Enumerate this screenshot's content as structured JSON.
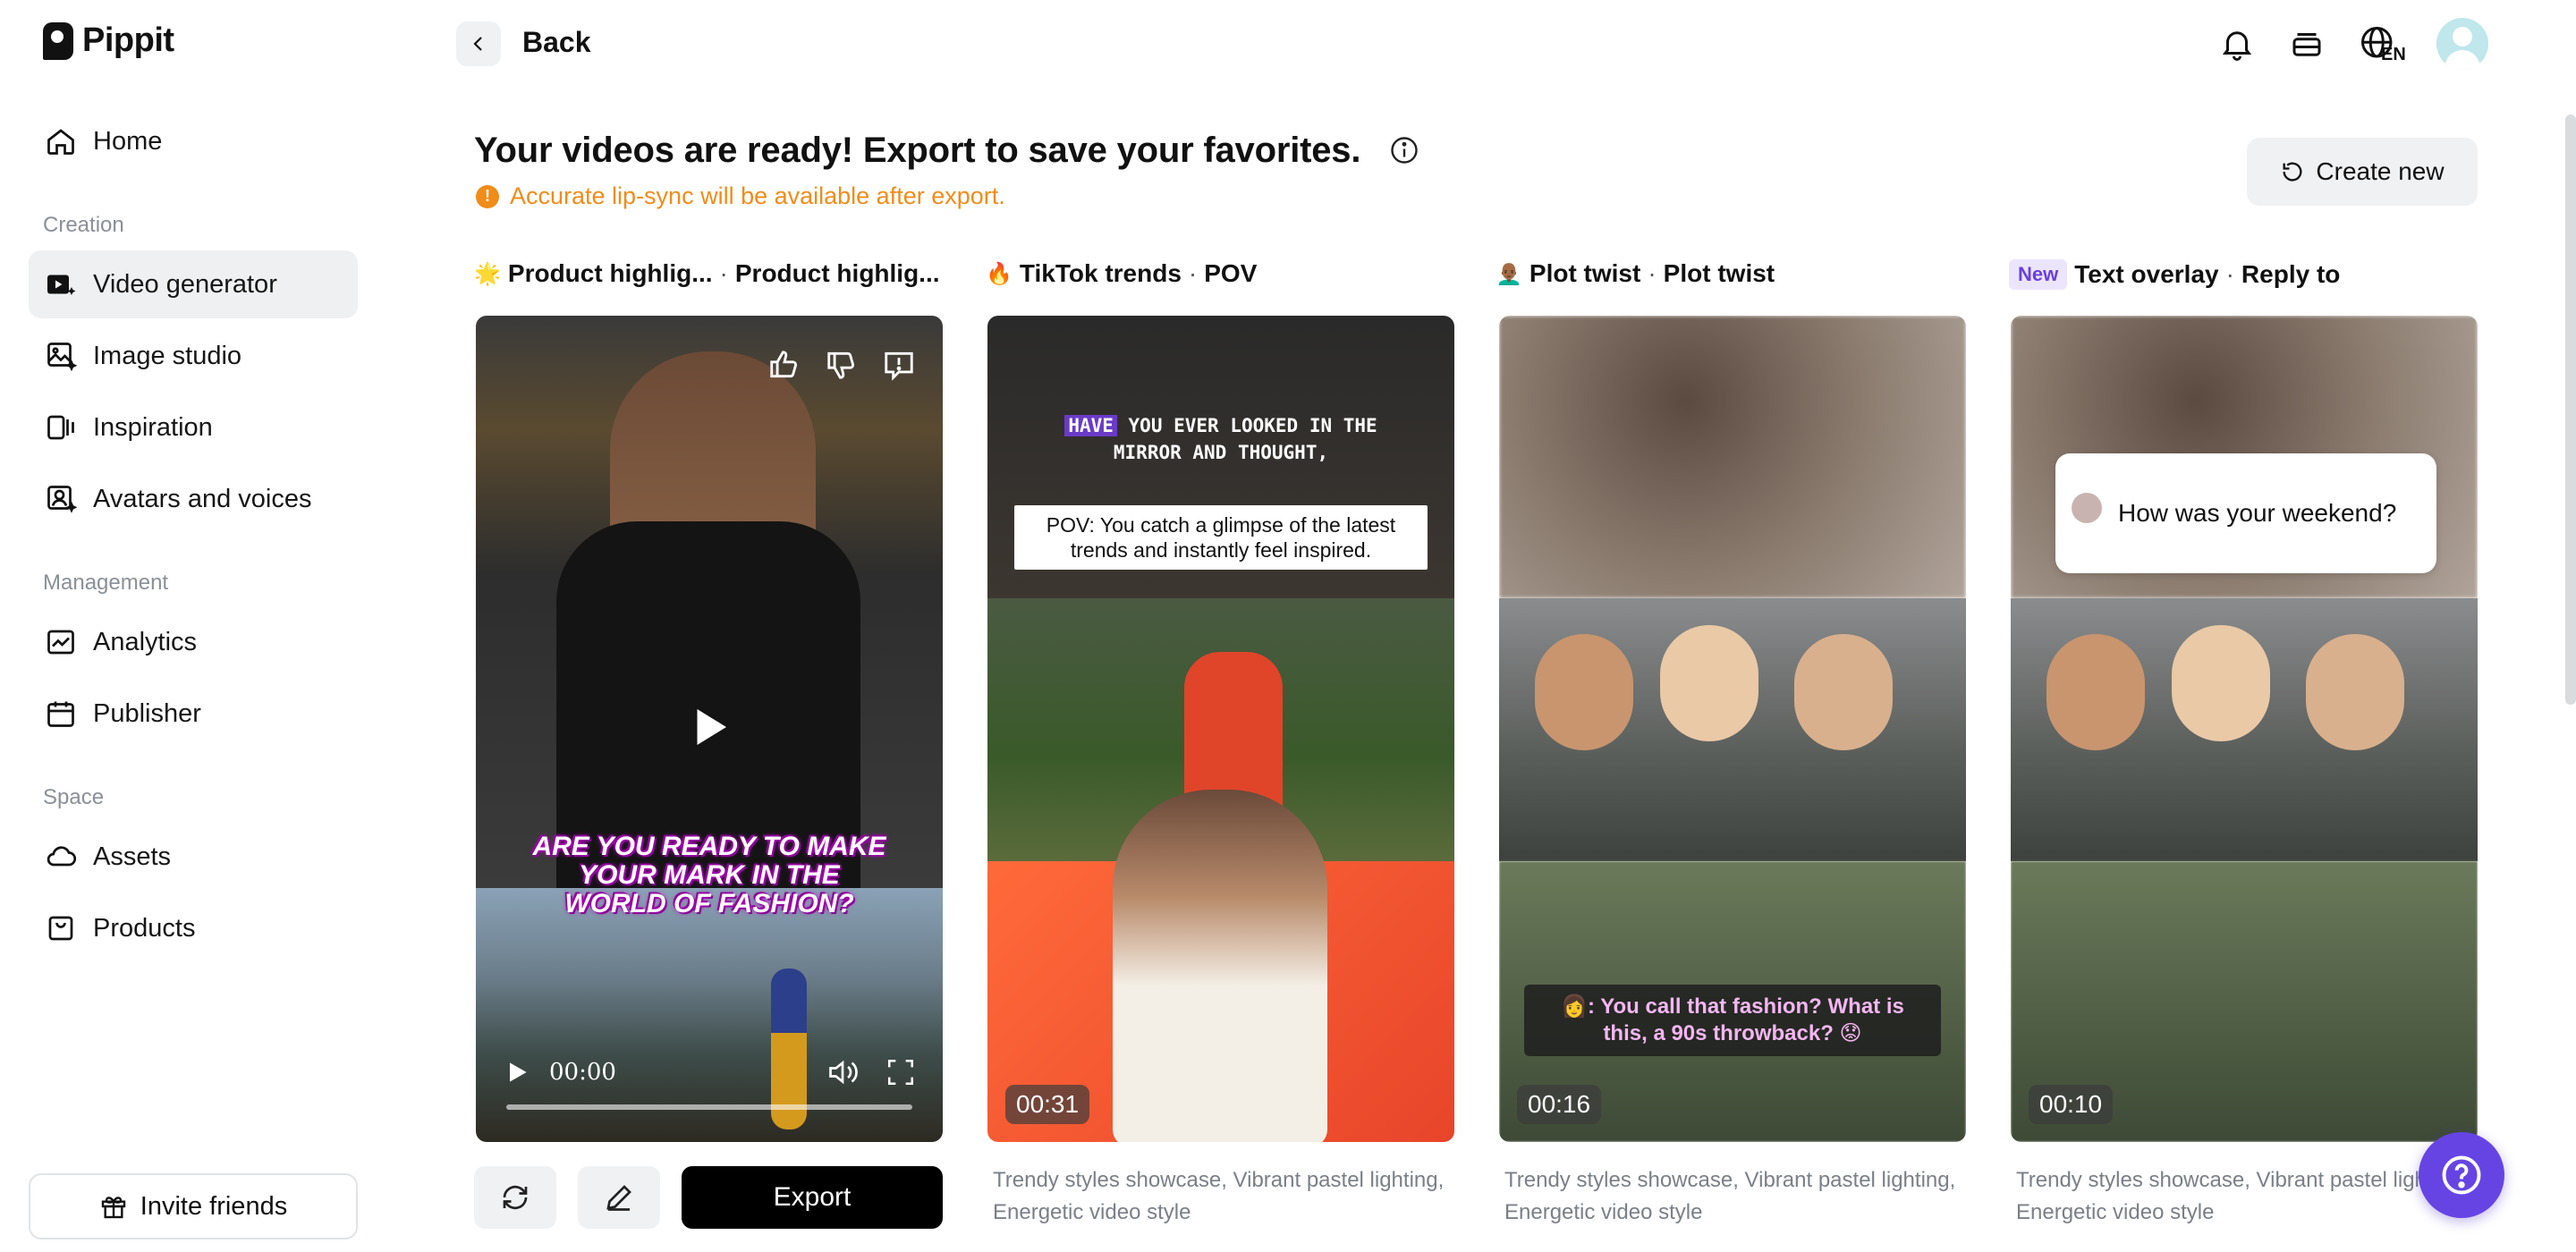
{
  "app": {
    "name": "Pippit"
  },
  "sidebar": {
    "items": [
      {
        "label": "Home",
        "icon": "home-icon"
      },
      {
        "section": "Creation"
      },
      {
        "label": "Video generator",
        "icon": "video-generator-icon",
        "active": true
      },
      {
        "label": "Image studio",
        "icon": "image-icon"
      },
      {
        "label": "Inspiration",
        "icon": "inspiration-icon"
      },
      {
        "label": "Avatars and voices",
        "icon": "avatar-icon"
      },
      {
        "section": "Management"
      },
      {
        "label": "Analytics",
        "icon": "analytics-icon"
      },
      {
        "label": "Publisher",
        "icon": "calendar-icon"
      },
      {
        "section": "Space"
      },
      {
        "label": "Assets",
        "icon": "cloud-icon"
      },
      {
        "label": "Products",
        "icon": "box-icon"
      }
    ],
    "invite_label": "Invite friends"
  },
  "topbar": {
    "back_label": "Back",
    "lang": "EN"
  },
  "header": {
    "title": "Your videos are ready! Export to save your favorites.",
    "warning": "Accurate lip-sync will be available after export.",
    "create_new_label": "Create new"
  },
  "cards": [
    {
      "emoji": "🌟",
      "title_a": "Product highlig...",
      "title_b": "Product highlig...",
      "caption": "ARE YOU READY TO MAKE YOUR MARK IN THE WORLD OF FASHION?",
      "time": "00:00",
      "export_label": "Export"
    },
    {
      "emoji": "🔥",
      "title_a": "TikTok trends",
      "title_b": "POV",
      "overlay_highlight": "HAVE",
      "overlay_top": " YOU EVER LOOKED IN THE MIRROR AND THOUGHT,",
      "overlay_box": "POV: You catch a glimpse of the latest trends and instantly feel inspired.",
      "duration": "00:31",
      "description": "Trendy styles showcase, Vibrant pastel lighting, Energetic video style"
    },
    {
      "emoji": "👨🏾‍🦲",
      "title_a": "Plot twist",
      "title_b": "Plot twist",
      "subtitle": "👩: You call that fashion? What is this, a 90s throwback? 😟",
      "duration": "00:16",
      "description": "Trendy styles showcase, Vibrant pastel lighting, Energetic video style"
    },
    {
      "badge": "New",
      "title_a": "Text overlay",
      "title_b": "Reply to",
      "bubble": "How was your weekend?",
      "duration": "00:10",
      "description": "Trendy styles showcase, Vibrant pastel lighting, Energetic video style"
    }
  ],
  "colors": {
    "accent": "#6644e4",
    "warning": "#f08c1a",
    "export": "#000000"
  }
}
